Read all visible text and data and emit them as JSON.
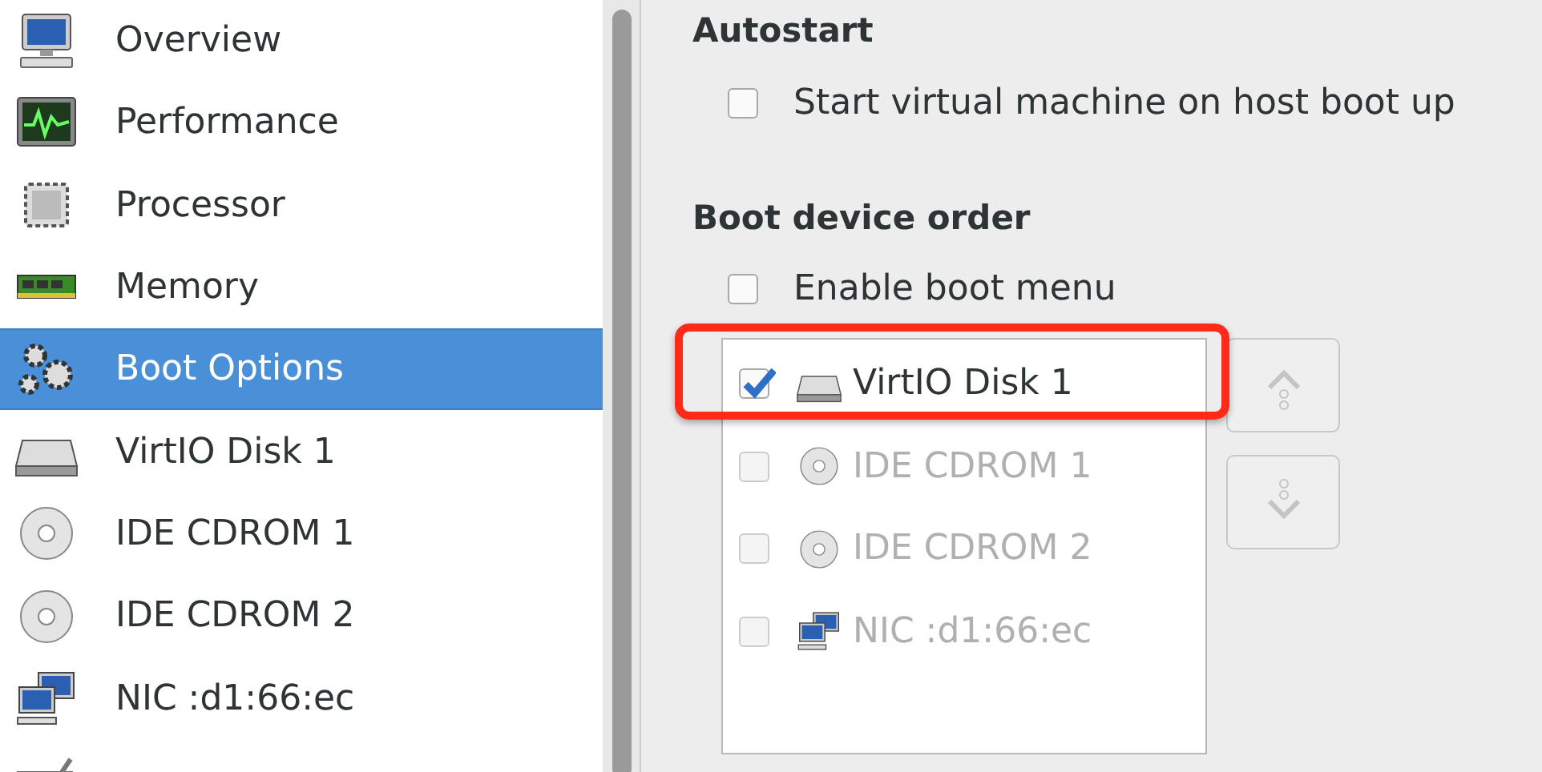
{
  "sidebar": {
    "items": [
      {
        "label": "Overview",
        "kind": "monitor",
        "selected": false
      },
      {
        "label": "Performance",
        "kind": "graph",
        "selected": false
      },
      {
        "label": "Processor",
        "kind": "chip",
        "selected": false
      },
      {
        "label": "Memory",
        "kind": "ram",
        "selected": false
      },
      {
        "label": "Boot Options",
        "kind": "gears",
        "selected": true
      },
      {
        "label": "VirtIO Disk 1",
        "kind": "disk",
        "selected": false
      },
      {
        "label": "IDE CDROM 1",
        "kind": "cd",
        "selected": false
      },
      {
        "label": "IDE CDROM 2",
        "kind": "cd",
        "selected": false
      },
      {
        "label": "NIC :d1:66:ec",
        "kind": "network",
        "selected": false
      },
      {
        "kind": "tablet",
        "selected": false
      }
    ]
  },
  "autostart": {
    "heading": "Autostart",
    "option": {
      "label": "Start virtual machine on host boot up",
      "checked": false
    }
  },
  "boot": {
    "heading": "Boot device order",
    "menu_option": {
      "label": "Enable boot menu",
      "checked": false
    },
    "devices": [
      {
        "label": "VirtIO Disk 1",
        "kind": "disk",
        "checked": true,
        "enabled": true,
        "highlighted": true
      },
      {
        "label": "IDE CDROM 1",
        "kind": "cd",
        "checked": false,
        "enabled": false,
        "highlighted": false
      },
      {
        "label": "IDE CDROM 2",
        "kind": "cd",
        "checked": false,
        "enabled": false,
        "highlighted": false
      },
      {
        "label": "NIC :d1:66:ec",
        "kind": "network",
        "checked": false,
        "enabled": false,
        "highlighted": false
      }
    ],
    "buttons": [
      {
        "kind": "up",
        "disabled": true
      },
      {
        "kind": "down",
        "disabled": true
      }
    ]
  }
}
